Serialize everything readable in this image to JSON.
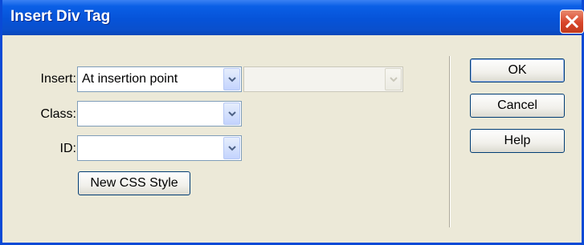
{
  "window": {
    "title": "Insert Div Tag"
  },
  "form": {
    "insert": {
      "label": "Insert:",
      "value": "At insertion point",
      "secondary_value": ""
    },
    "class": {
      "label": "Class:",
      "value": ""
    },
    "id": {
      "label": "ID:",
      "value": ""
    },
    "new_css_style_label": "New CSS Style"
  },
  "buttons": {
    "ok": "OK",
    "cancel": "Cancel",
    "help": "Help"
  },
  "icons": {
    "close": "close-icon",
    "dropdown": "chevron-down-icon"
  },
  "colors": {
    "titlebar": "#0653d8",
    "close": "#d8452a",
    "dialog_bg": "#ece9d8"
  }
}
